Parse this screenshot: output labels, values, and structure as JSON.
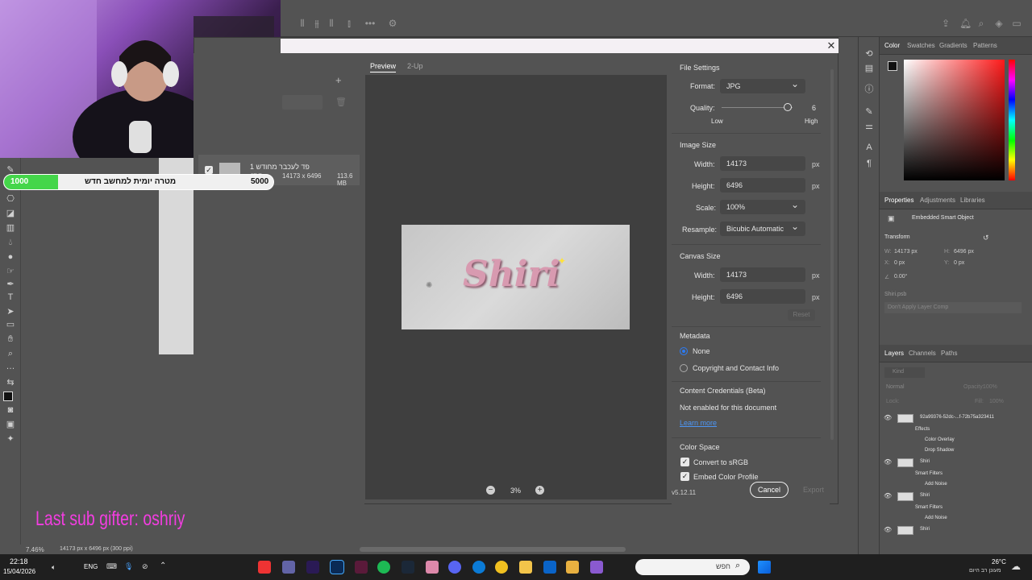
{
  "overlay": {
    "goal_start": "1000",
    "goal_label": "מטרה יומית למחשב חדש",
    "goal_end": "5000",
    "goal_progress": 0.2,
    "sub_gifter": "Last sub gifter: oshriy"
  },
  "left_pane": {
    "file_name": "פד לעכבר מחודש 1",
    "file_type": "JPG",
    "file_dims": "14173 x 6496",
    "file_size": "113.6 MB"
  },
  "preview": {
    "tabs": [
      "Preview",
      "2-Up"
    ],
    "artwork_text": "Shiri",
    "zoom_level": "3%"
  },
  "settings": {
    "file_settings_title": "File Settings",
    "format_label": "Format:",
    "format_value": "JPG",
    "quality_label": "Quality:",
    "quality_value": "6",
    "quality_fraction": 0.93,
    "quality_low": "Low",
    "quality_high": "High",
    "image_size_title": "Image Size",
    "width_label": "Width:",
    "height_label": "Height:",
    "image_width": "14173",
    "image_height": "6496",
    "unit": "px",
    "scale_label": "Scale:",
    "scale_value": "100%",
    "resample_label": "Resample:",
    "resample_value": "Bicubic Automatic",
    "canvas_size_title": "Canvas Size",
    "canvas_width": "14173",
    "canvas_height": "6496",
    "reset_label": "Reset",
    "metadata_title": "Metadata",
    "metadata_none": "None",
    "metadata_copyright": "Copyright and Contact Info",
    "credentials_title": "Content Credentials (Beta)",
    "credentials_status": "Not enabled for this document",
    "learn_more": "Learn more",
    "color_space_title": "Color Space",
    "convert_srgb": "Convert to sRGB",
    "embed_profile": "Embed Color Profile"
  },
  "footer": {
    "version": "v5.12.11",
    "cancel": "Cancel",
    "export": "Export"
  },
  "color_panel": {
    "tabs": [
      "Color",
      "Swatches",
      "Gradients",
      "Patterns"
    ]
  },
  "properties_panel": {
    "tabs": [
      "Properties",
      "Adjustments",
      "Libraries"
    ],
    "object_type": "Embedded Smart Object",
    "transform_title": "Transform",
    "w_label": "W:",
    "w_value": "14173 px",
    "h_label": "H:",
    "h_value": "6496 px",
    "x_label": "X:",
    "x_value": "0 px",
    "y_label": "Y:",
    "y_value": "0 px",
    "angle": "0.00°",
    "source_file": "Shiri.psb",
    "layer_comp": "Don't Apply Layer Comp"
  },
  "layers_panel": {
    "tabs": [
      "Layers",
      "Channels",
      "Paths"
    ],
    "search_placeholder": "Kind",
    "blend_mode": "Normal",
    "opacity_label": "Opacity:",
    "opacity_value": "100%",
    "lock_label": "Lock:",
    "fill_label": "Fill:",
    "fill_value": "100%",
    "rows": [
      {
        "name": "92a99376-52dc-...f-72b75a323411",
        "indent": 0,
        "kind": "layer"
      },
      {
        "name": "Effects",
        "indent": 1,
        "kind": "sub"
      },
      {
        "name": "Color Overlay",
        "indent": 2,
        "kind": "sub"
      },
      {
        "name": "Drop Shadow",
        "indent": 2,
        "kind": "sub"
      },
      {
        "name": "Shiri",
        "indent": 0,
        "kind": "layer"
      },
      {
        "name": "Smart Filters",
        "indent": 1,
        "kind": "sub"
      },
      {
        "name": "Add Noise",
        "indent": 2,
        "kind": "sub"
      },
      {
        "name": "Shiri",
        "indent": 0,
        "kind": "layer"
      },
      {
        "name": "Smart Filters",
        "indent": 1,
        "kind": "sub"
      },
      {
        "name": "Add Noise",
        "indent": 2,
        "kind": "sub"
      },
      {
        "name": "Shiri",
        "indent": 0,
        "kind": "layer"
      }
    ]
  },
  "status_bar": {
    "zoom": "7.46%",
    "doc_info": "14173 px x 6496 px (300 ppi)"
  },
  "taskbar": {
    "time": "22:18",
    "date": "15/04/2026",
    "lang": "ENG",
    "search_placeholder": "חפש",
    "weather_temp": "26°C",
    "weather_desc": "מעונן רב היום"
  }
}
